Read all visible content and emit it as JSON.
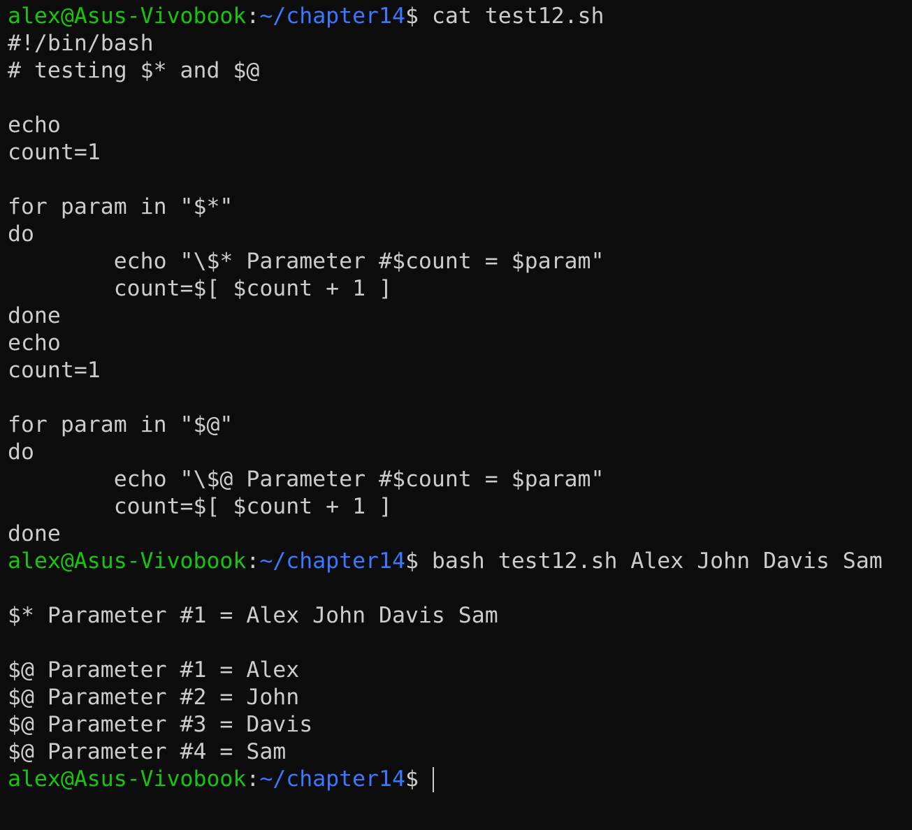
{
  "terminal": {
    "colors": {
      "background": "#0c0c0c",
      "foreground": "#cccccc",
      "prompt_user": "#16c60c",
      "prompt_path": "#3b78ff"
    },
    "prompt": {
      "user_host": "alex@Asus-Vivobook",
      "separator": ":",
      "path": "~/chapter14",
      "symbol": "$"
    },
    "commands": {
      "cat": "cat test12.sh",
      "run": "bash test12.sh Alex John Davis Sam"
    },
    "script_lines": [
      "#!/bin/bash",
      "# testing $* and $@",
      "",
      "echo",
      "count=1",
      "",
      "for param in \"$*\"",
      "do",
      "        echo \"\\$* Parameter #$count = $param\"",
      "        count=$[ $count + 1 ]",
      "done",
      "echo",
      "count=1",
      "",
      "for param in \"$@\"",
      "do",
      "        echo \"\\$@ Parameter #$count = $param\"",
      "        count=$[ $count + 1 ]",
      "done"
    ],
    "output_lines": [
      "",
      "$* Parameter #1 = Alex John Davis Sam",
      "",
      "$@ Parameter #1 = Alex",
      "$@ Parameter #2 = John",
      "$@ Parameter #3 = Davis",
      "$@ Parameter #4 = Sam"
    ]
  }
}
